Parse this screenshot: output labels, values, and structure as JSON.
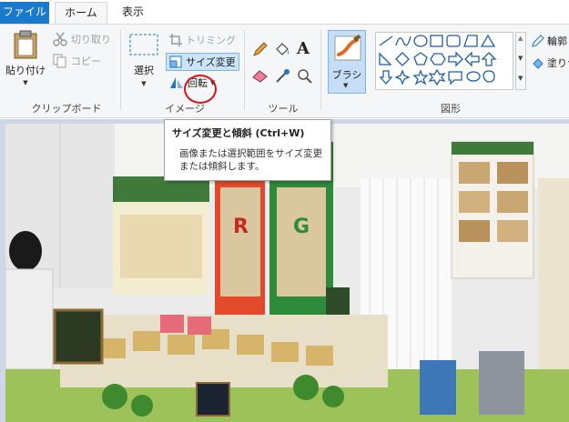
{
  "tabs": {
    "file": "ファイル",
    "home": "ホーム",
    "view": "表示"
  },
  "clipboard": {
    "paste": "貼り付け",
    "cut": "切り取り",
    "copy": "コピー",
    "group_label": "クリップボード"
  },
  "image": {
    "select": "選択",
    "crop": "トリミング",
    "resize": "サイズ変更",
    "rotate": "回転",
    "group_label": "イメージ"
  },
  "tools": {
    "group_label": "ツール",
    "icons": [
      "pencil-icon",
      "fill-icon",
      "text-icon",
      "eraser-icon",
      "color-picker-icon",
      "magnifier-icon"
    ]
  },
  "brushes": {
    "label": "ブラシ"
  },
  "shapes": {
    "group_label": "図形",
    "outline": "輪郭",
    "fill": "塗りつ"
  },
  "tooltip": {
    "title": "サイズ変更と傾斜 (Ctrl+W)",
    "body": "画像または選択範囲をサイズ変更または傾斜します。"
  },
  "colors": {
    "accent": "#1979ca",
    "ribbon": "#f5f6f7",
    "highlight": "#cce4f7",
    "annotation": "#d8141b"
  }
}
